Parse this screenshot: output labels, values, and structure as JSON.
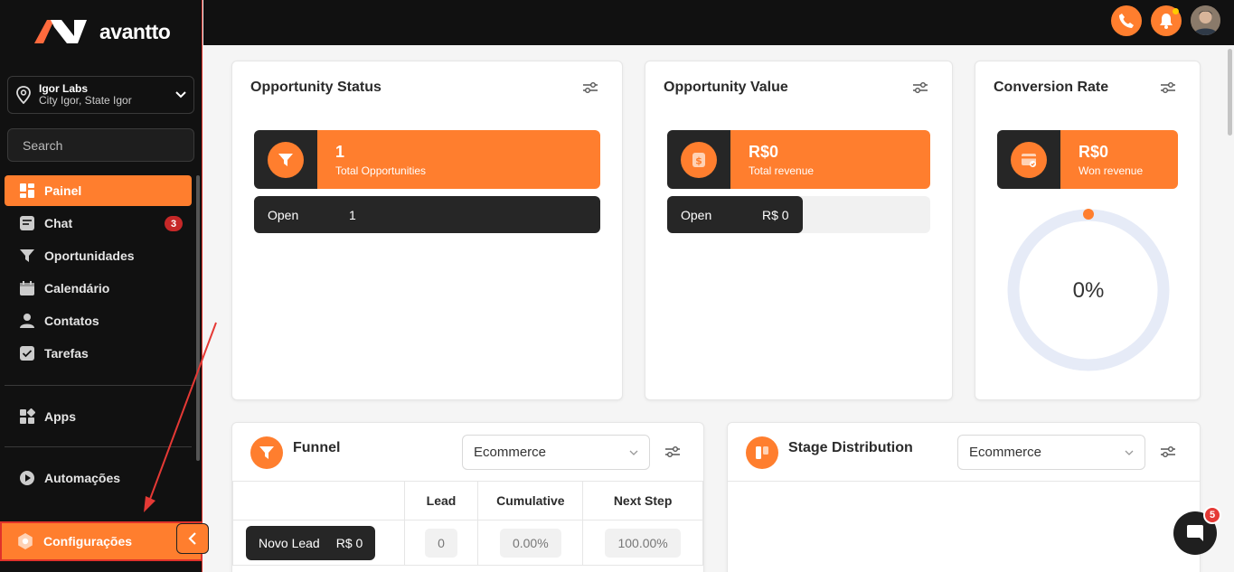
{
  "brand": {
    "name": "avantto",
    "accent": "#ff7e2e",
    "dark": "#111111"
  },
  "location": {
    "name": "Igor Labs",
    "address": "City Igor, State Igor",
    "icon": "map-pin-icon"
  },
  "search": {
    "placeholder": "Search",
    "icon": "search-icon"
  },
  "nav": {
    "items": [
      {
        "label": "Painel",
        "icon": "dashboard-icon",
        "active": true
      },
      {
        "label": "Chat",
        "icon": "chat-icon",
        "badge": "3"
      },
      {
        "label": "Oportunidades",
        "icon": "funnel-icon"
      },
      {
        "label": "Calendário",
        "icon": "calendar-icon"
      },
      {
        "label": "Contatos",
        "icon": "user-icon"
      },
      {
        "label": "Tarefas",
        "icon": "checkbox-icon"
      },
      {
        "label": "Apps",
        "icon": "apps-icon"
      },
      {
        "label": "Automações",
        "icon": "play-icon"
      }
    ],
    "settings": {
      "label": "Configurações",
      "icon": "gear-icon"
    }
  },
  "cards": {
    "opportunity_status": {
      "title": "Opportunity Status",
      "value": "1",
      "label": "Total Opportunities",
      "open_label": "Open",
      "open_value": "1"
    },
    "opportunity_value": {
      "title": "Opportunity Value",
      "value": "R$0",
      "label": "Total revenue",
      "open_label": "Open",
      "open_value": "R$ 0"
    },
    "conversion_rate": {
      "title": "Conversion Rate",
      "value": "R$0",
      "label": "Won revenue",
      "rate": "0%"
    },
    "funnel": {
      "title": "Funnel",
      "selected": "Ecommerce",
      "columns": [
        "",
        "Lead",
        "Cumulative",
        "Next Step"
      ],
      "rows": [
        {
          "stage": "Novo Lead",
          "amount": "R$ 0",
          "lead": "0",
          "cumulative": "0.00%",
          "next": "100.00%"
        }
      ]
    },
    "stage_distribution": {
      "title": "Stage Distribution",
      "selected": "Ecommerce"
    }
  },
  "chat_widget": {
    "badge": "5"
  }
}
